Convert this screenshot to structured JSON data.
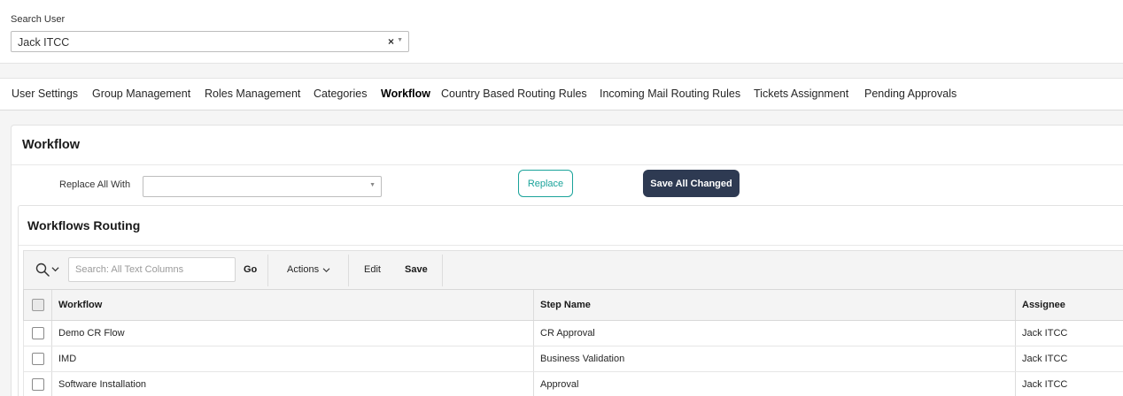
{
  "search_user": {
    "label": "Search User",
    "value": "Jack ITCC",
    "clear_symbol": "×",
    "caret_symbol": "▼"
  },
  "tabs": [
    {
      "label": "User Settings"
    },
    {
      "label": "Group Management"
    },
    {
      "label": "Roles Management"
    },
    {
      "label": "Categories"
    },
    {
      "label": "Workflow",
      "active": true
    },
    {
      "label": "Country Based Routing Rules"
    },
    {
      "label": "Incoming Mail Routing Rules"
    },
    {
      "label": "Tickets Assignment"
    },
    {
      "label": "Pending Approvals"
    }
  ],
  "workflow": {
    "title": "Workflow",
    "replace_all_label": "Replace All With",
    "replace_value": "",
    "replace_button": "Replace",
    "save_all_button": "Save All Changed",
    "caret_symbol": "▼"
  },
  "routing": {
    "title": "Workflows Routing",
    "toolbar": {
      "search_placeholder": "Search: All Text Columns",
      "go_label": "Go",
      "actions_label": "Actions",
      "edit_label": "Edit",
      "save_label": "Save"
    },
    "columns": {
      "workflow": "Workflow",
      "step_name": "Step Name",
      "assignee": "Assignee"
    },
    "rows": [
      {
        "workflow": "Demo CR Flow",
        "step_name": "CR Approval",
        "assignee": "Jack ITCC"
      },
      {
        "workflow": "IMD",
        "step_name": "Business Validation",
        "assignee": "Jack ITCC"
      },
      {
        "workflow": "Software Installation",
        "step_name": "Approval",
        "assignee": "Jack ITCC"
      }
    ]
  },
  "colors": {
    "accent_teal": "#1aa39a",
    "primary_dark": "#2e3a52"
  }
}
